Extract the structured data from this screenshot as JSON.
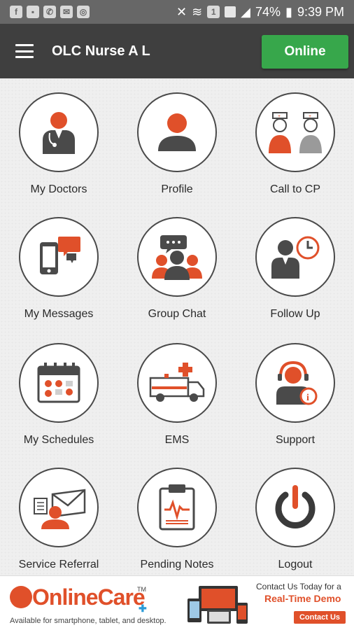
{
  "status_bar": {
    "battery_percent": "74%",
    "time": "9:39 PM",
    "signal_badge": "1"
  },
  "app_bar": {
    "title": "OLC Nurse A L",
    "status_button_label": "Online",
    "status_button_color": "#37a74b"
  },
  "menu": {
    "items": [
      {
        "label": "My Doctors",
        "icon": "doctor-stethoscope-icon"
      },
      {
        "label": "Profile",
        "icon": "user-silhouette-icon"
      },
      {
        "label": "Call to CP",
        "icon": "two-nurses-icon"
      },
      {
        "label": "My Messages",
        "icon": "phone-chat-icon"
      },
      {
        "label": "Group Chat",
        "icon": "group-chat-icon"
      },
      {
        "label": "Follow Up",
        "icon": "doctor-clock-icon"
      },
      {
        "label": "My Schedules",
        "icon": "calendar-icon"
      },
      {
        "label": "EMS",
        "icon": "ambulance-icon"
      },
      {
        "label": "Support",
        "icon": "headset-agent-icon"
      },
      {
        "label": "Service Referral",
        "icon": "referral-envelope-icon"
      },
      {
        "label": "Pending Notes",
        "icon": "clipboard-heartbeat-icon"
      },
      {
        "label": "Logout",
        "icon": "power-icon"
      }
    ]
  },
  "ad_banner": {
    "brand": "OnlineCare",
    "trademark": "TM",
    "tagline": "Available for smartphone, tablet, and desktop.",
    "contact_line": "Contact Us Today for a",
    "demo_line": "Real-Time Demo",
    "cta_label": "Contact Us"
  },
  "colors": {
    "accent": "#e0502a",
    "dark": "#3f3f3f",
    "icon_gray": "#4a4a4a"
  }
}
